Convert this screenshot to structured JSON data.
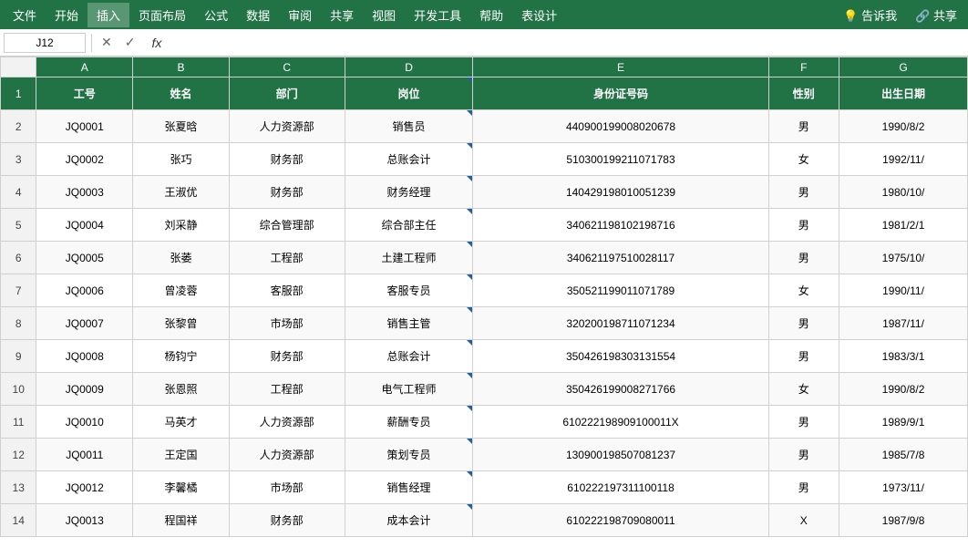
{
  "menubar": {
    "items": [
      "文件",
      "开始",
      "插入",
      "页面布局",
      "公式",
      "数据",
      "审阅",
      "共享",
      "视图",
      "开发工具",
      "帮助",
      "表设计"
    ],
    "active_item": "插入",
    "right_items": [
      "💡 告诉我",
      "🔗 共享"
    ]
  },
  "formula_bar": {
    "cell_ref": "J12",
    "formula": "",
    "icons": [
      "✕",
      "✓",
      "fx"
    ]
  },
  "columns": {
    "headers": [
      "",
      "A",
      "B",
      "C",
      "D",
      "E",
      "F",
      "G"
    ],
    "labels": [
      "",
      "工号",
      "姓名",
      "部门",
      "岗位",
      "身份证号码",
      "性别",
      "出生日期"
    ]
  },
  "rows": [
    {
      "num": "1",
      "selected": true
    },
    {
      "num": "2",
      "a": "JQ0001",
      "b": "张夏晗",
      "c": "人力资源部",
      "d": "销售员",
      "e": "440900199008020678",
      "f": "男",
      "g": "1990/8/2"
    },
    {
      "num": "3",
      "a": "JQ0002",
      "b": "张巧",
      "c": "财务部",
      "d": "总账会计",
      "e": "510300199211071783",
      "f": "女",
      "g": "1992/11/"
    },
    {
      "num": "4",
      "a": "JQ0003",
      "b": "王淑优",
      "c": "财务部",
      "d": "财务经理",
      "e": "140429198010051239",
      "f": "男",
      "g": "1980/10/"
    },
    {
      "num": "5",
      "a": "JQ0004",
      "b": "刘采静",
      "c": "综合管理部",
      "d": "综合部主任",
      "e": "340621198102198716",
      "f": "男",
      "g": "1981/2/1"
    },
    {
      "num": "6",
      "a": "JQ0005",
      "b": "张萎",
      "c": "工程部",
      "d": "土建工程师",
      "e": "340621197510028117",
      "f": "男",
      "g": "1975/10/"
    },
    {
      "num": "7",
      "a": "JQ0006",
      "b": "曾凌蓉",
      "c": "客服部",
      "d": "客服专员",
      "e": "350521199011071789",
      "f": "女",
      "g": "1990/11/"
    },
    {
      "num": "8",
      "a": "JQ0007",
      "b": "张黎曾",
      "c": "市场部",
      "d": "销售主管",
      "e": "320200198711071234",
      "f": "男",
      "g": "1987/11/"
    },
    {
      "num": "9",
      "a": "JQ0008",
      "b": "杨钧宁",
      "c": "财务部",
      "d": "总账会计",
      "e": "350426198303131554",
      "f": "男",
      "g": "1983/3/1"
    },
    {
      "num": "10",
      "a": "JQ0009",
      "b": "张恩照",
      "c": "工程部",
      "d": "电气工程师",
      "e": "350426199008271766",
      "f": "女",
      "g": "1990/8/2"
    },
    {
      "num": "11",
      "a": "JQ0010",
      "b": "马英才",
      "c": "人力资源部",
      "d": "薪酬专员",
      "e": "610222198909100011X",
      "f": "男",
      "g": "1989/9/1"
    },
    {
      "num": "12",
      "a": "JQ0011",
      "b": "王定国",
      "c": "人力资源部",
      "d": "策划专员",
      "e": "130900198507081237",
      "f": "男",
      "g": "1985/7/8"
    },
    {
      "num": "13",
      "a": "JQ0012",
      "b": "李馨橘",
      "c": "市场部",
      "d": "销售经理",
      "e": "610222197311100118",
      "f": "男",
      "g": "1973/11/"
    },
    {
      "num": "14",
      "a": "JQ0013",
      "b": "程国祥",
      "c": "财务部",
      "d": "成本会计",
      "e": "610222198709080011",
      "f": "X",
      "g": "1987/9/8"
    }
  ]
}
